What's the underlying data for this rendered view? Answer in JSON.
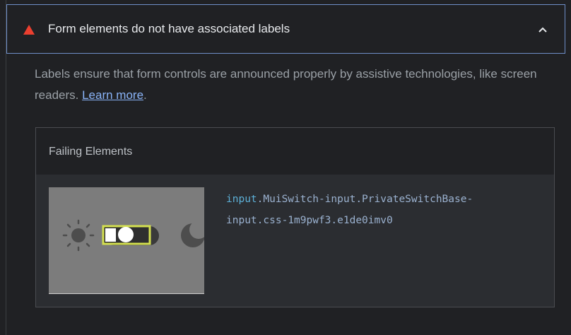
{
  "audit": {
    "title": "Form elements do not have associated labels",
    "status_icon": "fail-triangle-icon",
    "status_color": "#eb3f2f",
    "expand_icon": "chevron-up-icon",
    "description_text": "Labels ensure that form controls are announced properly by assistive technologies, like screen readers. ",
    "learn_more": "Learn more",
    "description_end": "."
  },
  "table": {
    "header": "Failing Elements",
    "rows": [
      {
        "node_tag": "input",
        "node_selector_line1": ".MuiSwitch-input.PrivateSwitchBase-",
        "node_selector_line2": "input.css-1m9pwf3.e1de0imv0",
        "screenshot_icons": [
          "sun-icon",
          "switch-toggle",
          "moon-icon"
        ],
        "highlight_color": "#d4e04f"
      }
    ]
  },
  "colors": {
    "accent_border": "#6f8fc9",
    "link": "#8ab4f8"
  }
}
